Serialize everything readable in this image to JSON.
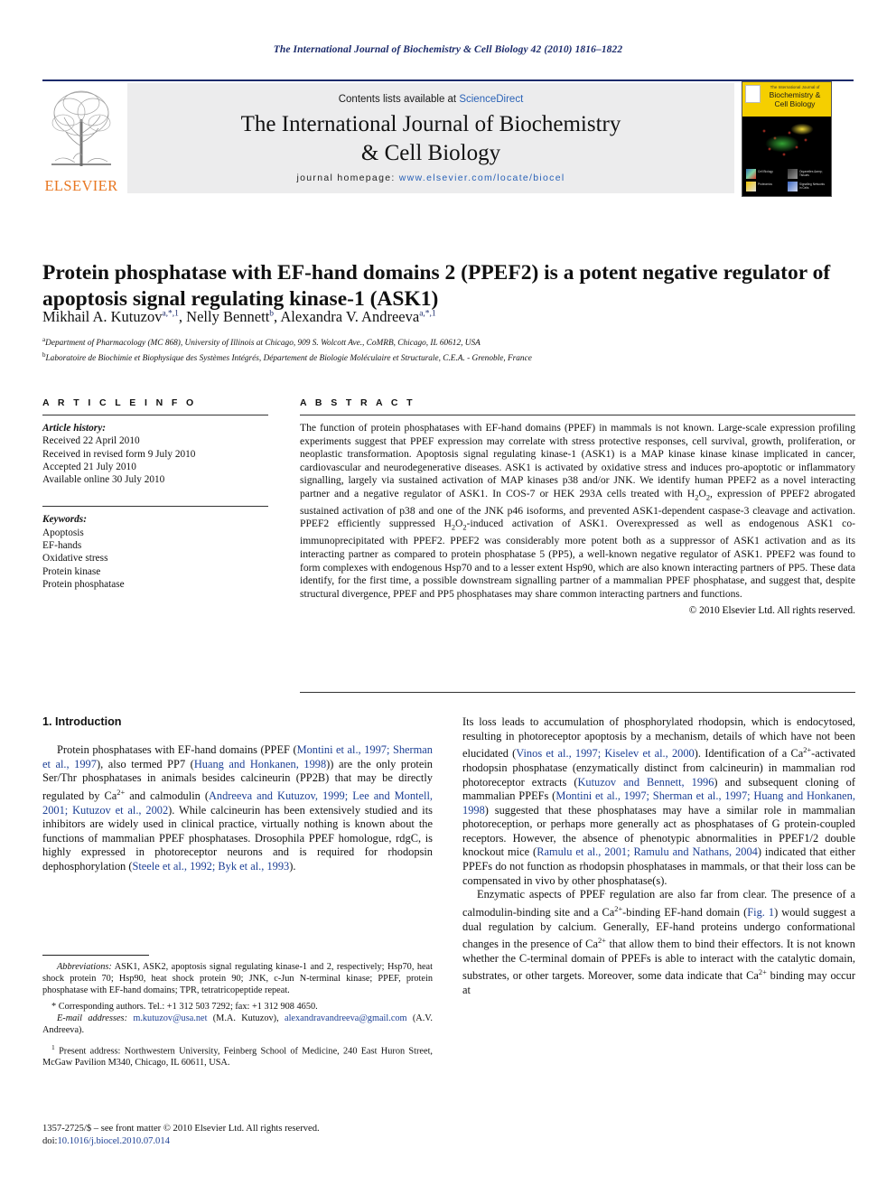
{
  "running_head": "The International Journal of Biochemistry & Cell Biology 42 (2010) 1816–1822",
  "header": {
    "publisher": "ELSEVIER",
    "contents_prefix": "Contents lists available at ",
    "contents_link": "ScienceDirect",
    "journal_title_line1": "The International Journal of Biochemistry",
    "journal_title_line2": "& Cell Biology",
    "homepage_prefix": "journal homepage: ",
    "homepage_url": "www.elsevier.com/locate/biocel",
    "cover": {
      "small_line": "The International Journal of",
      "title_line1": "Biochemistry &",
      "title_line2": "Cell Biology",
      "cells": [
        "Cell Biology",
        "Organelles &amp; Tissues",
        "Proteomics",
        "Signalling Networks in Cells"
      ]
    }
  },
  "article": {
    "title": "Protein phosphatase with EF-hand domains 2 (PPEF2) is a potent negative regulator of apoptosis signal regulating kinase-1 (ASK1)",
    "authors": [
      {
        "name": "Mikhail A. Kutuzov",
        "marks": "a,*,1",
        "sep": ", "
      },
      {
        "name": "Nelly Bennett",
        "marks": "b",
        "sep": ", "
      },
      {
        "name": "Alexandra V. Andreeva",
        "marks": "a,*,1",
        "sep": ""
      }
    ],
    "affiliations": [
      {
        "mark": "a",
        "text": "Department of Pharmacology (MC 868), University of Illinois at Chicago, 909 S. Wolcott Ave., CoMRB, Chicago, IL 60612, USA"
      },
      {
        "mark": "b",
        "text": "Laboratoire de Biochimie et Biophysique des Systèmes Intégrés, Département de Biologie Moléculaire et Structurale, C.E.A. - Grenoble, France"
      }
    ]
  },
  "article_info": {
    "label": "A R T I C L E    I N F O",
    "history_heading": "Article history:",
    "history": [
      "Received 22 April 2010",
      "Received in revised form 9 July 2010",
      "Accepted 21 July 2010",
      "Available online 30 July 2010"
    ],
    "keywords_heading": "Keywords:",
    "keywords": [
      "Apoptosis",
      "EF-hands",
      "Oxidative stress",
      "Protein kinase",
      "Protein phosphatase"
    ]
  },
  "abstract": {
    "label": "A B S T R A C T",
    "text": "The function of protein phosphatases with EF-hand domains (PPEF) in mammals is not known. Large-scale expression profiling experiments suggest that PPEF expression may correlate with stress protective responses, cell survival, growth, proliferation, or neoplastic transformation. Apoptosis signal regulating kinase-1 (ASK1) is a MAP kinase kinase kinase implicated in cancer, cardiovascular and neurodegenerative diseases. ASK1 is activated by oxidative stress and induces pro-apoptotic or inflammatory signalling, largely via sustained activation of MAP kinases p38 and/or JNK. We identify human PPEF2 as a novel interacting partner and a negative regulator of ASK1. In COS-7 or HEK 293A cells treated with H2O2, expression of PPEF2 abrogated sustained activation of p38 and one of the JNK p46 isoforms, and prevented ASK1-dependent caspase-3 cleavage and activation. PPEF2 efficiently suppressed H2O2-induced activation of ASK1. Overexpressed as well as endogenous ASK1 co-immunoprecipitated with PPEF2. PPEF2 was considerably more potent both as a suppressor of ASK1 activation and as its interacting partner as compared to protein phosphatase 5 (PP5), a well-known negative regulator of ASK1. PPEF2 was found to form complexes with endogenous Hsp70 and to a lesser extent Hsp90, which are also known interacting partners of PP5. These data identify, for the first time, a possible downstream signalling partner of a mammalian PPEF phosphatase, and suggest that, despite structural divergence, PPEF and PP5 phosphatases may share common interacting partners and functions.",
    "copyright": "© 2010 Elsevier Ltd. All rights reserved."
  },
  "body": {
    "section_heading": "1. Introduction",
    "left_paragraph": "Protein phosphatases with EF-hand domains (PPEF (Montini et al., 1997; Sherman et al., 1997), also termed PP7 (Huang and Honkanen, 1998)) are the only protein Ser/Thr phosphatases in animals besides calcineurin (PP2B) that may be directly regulated by Ca2+ and calmodulin (Andreeva and Kutuzov, 1999; Lee and Montell, 2001; Kutuzov et al., 2002). While calcineurin has been extensively studied and its inhibitors are widely used in clinical practice, virtually nothing is known about the functions of mammalian PPEF phosphatases. Drosophila PPEF homologue, rdgC, is highly expressed in photoreceptor neurons and is required for rhodopsin dephosphorylation (Steele et al., 1992; Byk et al., 1993).",
    "right_paragraph_1": "Its loss leads to accumulation of phosphorylated rhodopsin, which is endocytosed, resulting in photoreceptor apoptosis by a mechanism, details of which have not been elucidated (Vinos et al., 1997; Kiselev et al., 2000). Identification of a Ca2+-activated rhodopsin phosphatase (enzymatically distinct from calcineurin) in mammalian rod photoreceptor extracts (Kutuzov and Bennett, 1996) and subsequent cloning of mammalian PPEFs (Montini et al., 1997; Sherman et al., 1997; Huang and Honkanen, 1998) suggested that these phosphatases may have a similar role in mammalian photoreception, or perhaps more generally act as phosphatases of G protein-coupled receptors. However, the absence of phenotypic abnormalities in PPEF1/2 double knockout mice (Ramulu et al., 2001; Ramulu and Nathans, 2004) indicated that either PPEFs do not function as rhodopsin phosphatases in mammals, or that their loss can be compensated in vivo by other phosphatase(s).",
    "right_paragraph_2": "Enzymatic aspects of PPEF regulation are also far from clear. The presence of a calmodulin-binding site and a Ca2+-binding EF-hand domain (Fig. 1) would suggest a dual regulation by calcium. Generally, EF-hand proteins undergo conformational changes in the presence of Ca2+ that allow them to bind their effectors. It is not known whether the C-terminal domain of PPEFs is able to interact with the catalytic domain, substrates, or other targets. Moreover, some data indicate that Ca2+ binding may occur at"
  },
  "footnotes": {
    "abbreviations_label": "Abbreviations:",
    "abbreviations_text": " ASK1, ASK2, apoptosis signal regulating kinase-1 and 2, respectively; Hsp70, heat shock protein 70; Hsp90, heat shock protein 90; JNK, c-Jun N-terminal kinase; PPEF, protein phosphatase with EF-hand domains; TPR, tetratricopeptide repeat.",
    "corresponding": "* Corresponding authors. Tel.: +1 312 503 7292; fax: +1 312 908 4650.",
    "email_label": "E-mail addresses:",
    "email_1": "m.kutuzov@usa.net",
    "email_1_owner": " (M.A. Kutuzov),",
    "email_2": "alexandravandreeva@gmail.com",
    "email_2_owner": " (A.V. Andreeva).",
    "present_address": "Present address: Northwestern University, Feinberg School of Medicine, 240 East Huron Street, McGaw Pavilion M340, Chicago, IL 60611, USA.",
    "present_address_mark": "1"
  },
  "issn": {
    "line1": "1357-2725/$ – see front matter © 2010 Elsevier Ltd. All rights reserved.",
    "doi_label": "doi:",
    "doi_value": "10.1016/j.biocel.2010.07.014"
  },
  "colors": {
    "running_head": "#1c2b6b",
    "link": "#2a62b7",
    "reference": "#1c3f94",
    "elsevier_orange": "#e87722",
    "header_band": "#ececed",
    "cover_yellow": "#f5cf00"
  }
}
